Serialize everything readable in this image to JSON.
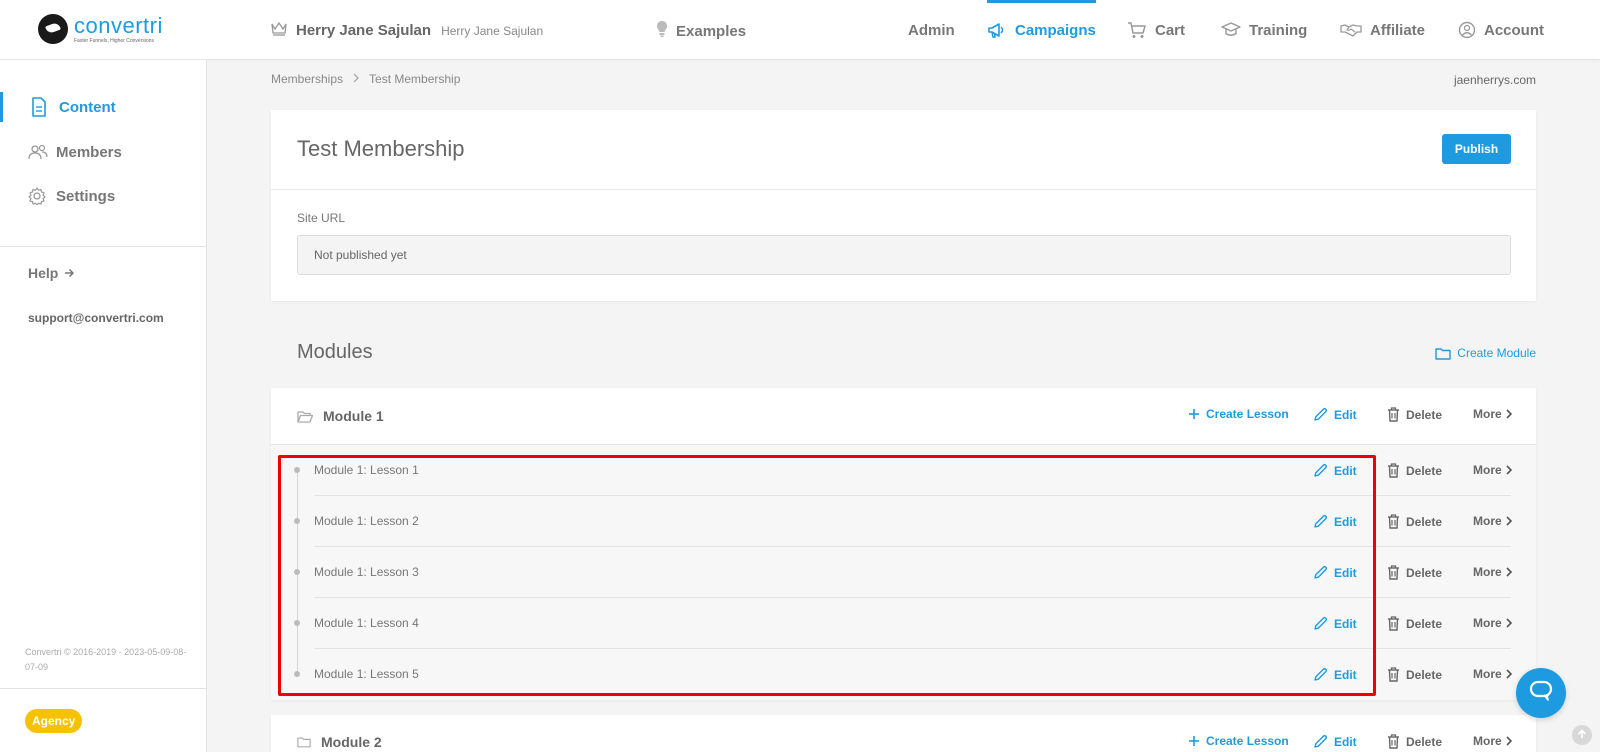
{
  "brand": {
    "name": "convertri",
    "tagline": "Faster Funnels, Higher Conversions"
  },
  "header": {
    "user_name": "Herry Jane Sajulan",
    "user_sub": "Herry Jane Sajulan",
    "examples_label": "Examples",
    "nav": {
      "admin": "Admin",
      "campaigns": "Campaigns",
      "cart": "Cart",
      "training": "Training",
      "affiliate": "Affiliate",
      "account": "Account"
    },
    "active_nav": "Campaigns"
  },
  "sidebar": {
    "items": [
      {
        "label": "Content",
        "icon": "document-icon",
        "active": true
      },
      {
        "label": "Members",
        "icon": "users-icon",
        "active": false
      },
      {
        "label": "Settings",
        "icon": "gear-icon",
        "active": false
      }
    ],
    "help_label": "Help",
    "support_email": "support@convertri.com",
    "copyright": "Convertri © 2016-2019 - 2023-05-09-08-07-09",
    "badge": "Agency"
  },
  "breadcrumb": {
    "parent": "Memberships",
    "current": "Test Membership"
  },
  "domain": "jaenherrys.com",
  "membership": {
    "title": "Test Membership",
    "publish_label": "Publish",
    "site_url_label": "Site URL",
    "site_url_value": "Not published yet"
  },
  "modules_section": {
    "title": "Modules",
    "create_module_label": "Create Module"
  },
  "actions": {
    "create_lesson": "Create Lesson",
    "edit": "Edit",
    "delete": "Delete",
    "more": "More"
  },
  "modules": [
    {
      "name": "Module 1",
      "lessons": [
        "Module 1: Lesson 1",
        "Module 1: Lesson 2",
        "Module 1: Lesson 3",
        "Module 1: Lesson 4",
        "Module 1: Lesson 5"
      ]
    },
    {
      "name": "Module 2",
      "lessons": []
    }
  ],
  "colors": {
    "accent": "#1e9be0",
    "highlight": "#ee0000",
    "badge": "#f5c200"
  }
}
